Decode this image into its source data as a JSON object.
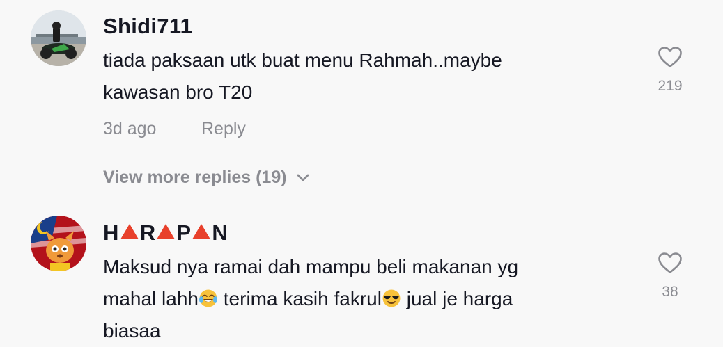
{
  "comments": [
    {
      "username": "Shidi711",
      "text_lines": [
        "tiada paksaan utk buat menu Rahmah..maybe",
        "kawasan bro T20"
      ],
      "time": "3d ago",
      "reply_label": "Reply",
      "likes": "219"
    },
    {
      "username_parts": [
        "H",
        "R",
        "P",
        "N"
      ],
      "text_parts": {
        "line1": "Maksud nya ramai dah mampu beli makanan yg",
        "line2a": "mahal lahh",
        "line2b": " terima kasih fakrul",
        "line2c": " jual je harga",
        "line3": "biasaa"
      },
      "likes": "38"
    }
  ],
  "view_more_replies": "View more replies (19)",
  "colors": {
    "background": "#f8f8f8",
    "primary_text": "#161823",
    "secondary_text": "#8a8b91",
    "triangle_red": "#e8402b"
  },
  "icons": {
    "like": "heart-outline-icon",
    "expand": "chevron-down-icon",
    "emoji_laugh": "face-with-tears-of-joy-emoji",
    "emoji_cool": "smiling-face-with-sunglasses-emoji"
  }
}
